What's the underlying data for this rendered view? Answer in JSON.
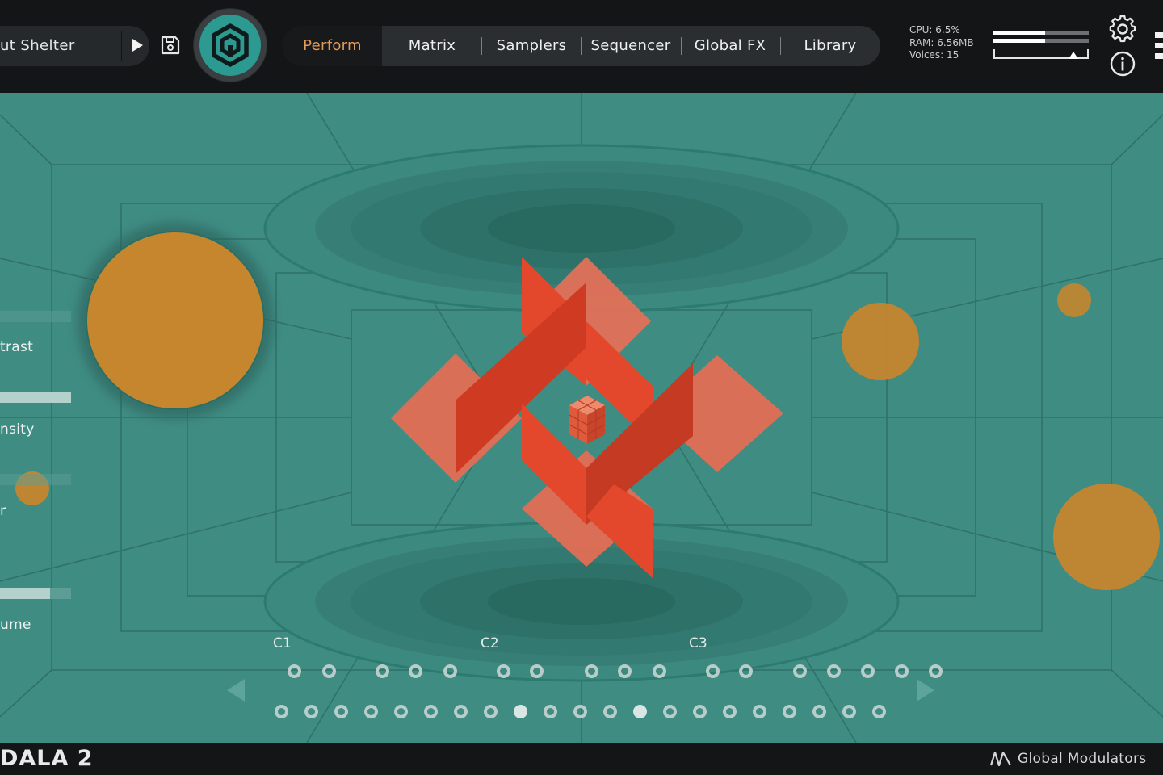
{
  "header": {
    "preset_name": "ut Shelter",
    "tabs": [
      {
        "label": "Perform",
        "active": true
      },
      {
        "label": "Matrix"
      },
      {
        "label": "Samplers"
      },
      {
        "label": "Sequencer"
      },
      {
        "label": "Global FX"
      },
      {
        "label": "Library"
      }
    ],
    "stats": {
      "cpu": "CPU: 6.5%",
      "ram": "RAM: 6.56MB",
      "voices": "Voices: 15"
    },
    "output_meter": {
      "left_level": 0.54,
      "right_level": 0.54,
      "volume": 0.84
    }
  },
  "icons": {
    "play": "play-icon",
    "save": "save-icon",
    "logo": "hexagon-logo-icon",
    "settings": "gear-icon",
    "info": "info-icon",
    "global_modulators": "wave-icon"
  },
  "left_panel": {
    "params": [
      {
        "label": "trast",
        "value": 0.0
      },
      {
        "label": "nsity",
        "value": 1.0
      },
      {
        "label": "r",
        "value": 0.0
      },
      {
        "label": "ume",
        "value": 0.7
      }
    ]
  },
  "pad_rows": {
    "labels": [
      "C1",
      "C2",
      "C3"
    ],
    "top_row_count": 17,
    "bottom_row_count": 21,
    "bottom_row_active": [
      8,
      12
    ]
  },
  "footer": {
    "brand": "DALA 2",
    "global_modulators": "Global Modulators"
  },
  "colors": {
    "background": "#3f8c83",
    "accent_orange": "#e49a5a",
    "orb": "#c5862e",
    "shape_red": "#e24a2c",
    "logo_teal": "#2d9a91"
  }
}
